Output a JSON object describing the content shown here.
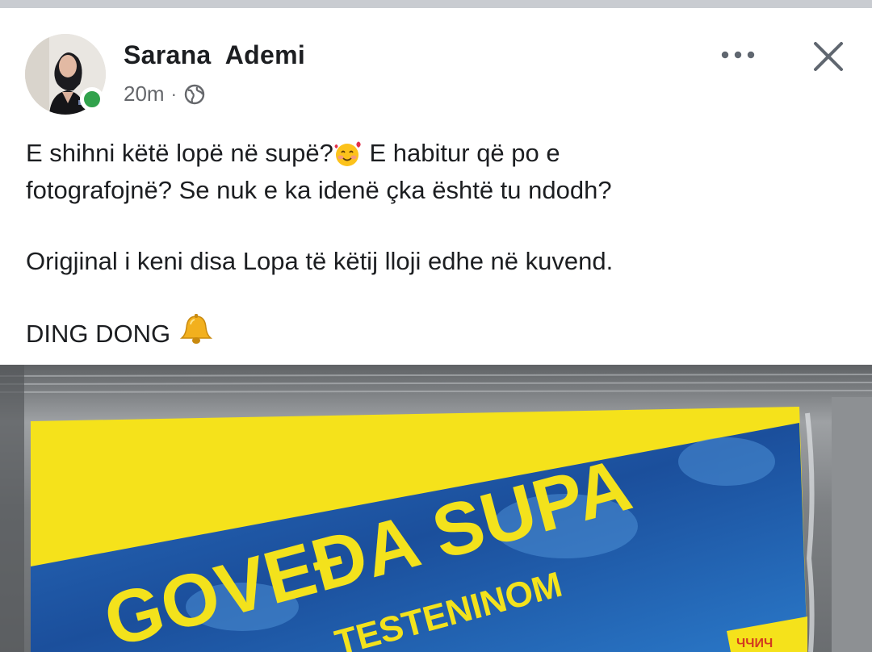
{
  "post": {
    "author": "Sarana  Ademi",
    "time": "20m",
    "separator": "·",
    "privacy_icon": "globe-icon",
    "more_icon": "more-horizontal-icon",
    "close_icon": "close-icon",
    "text_line1_a": "E shihni këtë lopë në supë?",
    "text_line1_b": " E habitur që po e",
    "text_line2": "fotografojnë? Se nuk e ka idenë çka është tu ndodh?",
    "text_para2": "Origjinal i keni disa Lopa të këtij lloji edhe në kuvend.",
    "text_para3": "DING DONG ",
    "emoji_1": "smiling-face-with-hearts",
    "emoji_2": "bell",
    "online_color": "#31a24c"
  },
  "photo": {
    "headline": "GOVEĐA SUPA",
    "subline": "TESTENINOM",
    "corner_text": "ЧЧИЧ",
    "colors": {
      "yellow": "#f5e21b",
      "blue": "#1d57a6",
      "text_yellow": "#f3e21c",
      "foil": "#8c8f92"
    }
  }
}
